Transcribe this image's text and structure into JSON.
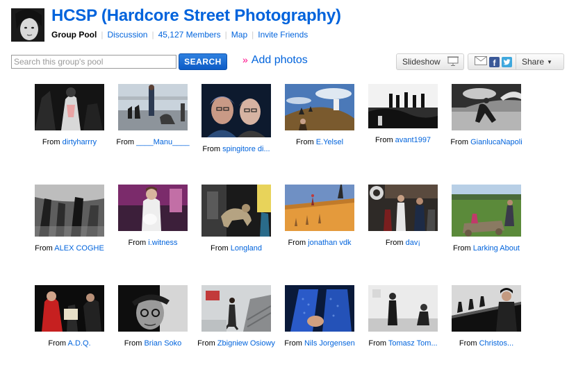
{
  "group": {
    "title": "HCSP (Hardcore Street Photography)"
  },
  "subnav": {
    "group_pool": "Group Pool",
    "discussion": "Discussion",
    "members": "45,127 Members",
    "map": "Map",
    "invite": "Invite Friends"
  },
  "search": {
    "placeholder": "Search this group's pool",
    "button": "SEARCH"
  },
  "add_photos": "Add photos",
  "slideshow_label": "Slideshow",
  "share_label": "Share",
  "from_label": "From",
  "photos": [
    {
      "owner": "dirtyharrry"
    },
    {
      "owner": "____Manu____"
    },
    {
      "owner": "spingitore di..."
    },
    {
      "owner": "E.Yelsel"
    },
    {
      "owner": "avant1997"
    },
    {
      "owner": "GianlucaNapoli"
    },
    {
      "owner": "ALEX COGHE"
    },
    {
      "owner": "i.witness"
    },
    {
      "owner": "Longland"
    },
    {
      "owner": "jonathan vdk"
    },
    {
      "owner": "dav¡"
    },
    {
      "owner": "Larking About"
    },
    {
      "owner": "A.D.Q."
    },
    {
      "owner": "Brian Soko"
    },
    {
      "owner": "Zbigniew Osiowy"
    },
    {
      "owner": "Nils Jorgensen"
    },
    {
      "owner": "Tomasz Tom..."
    },
    {
      "owner": "Christos..."
    }
  ]
}
